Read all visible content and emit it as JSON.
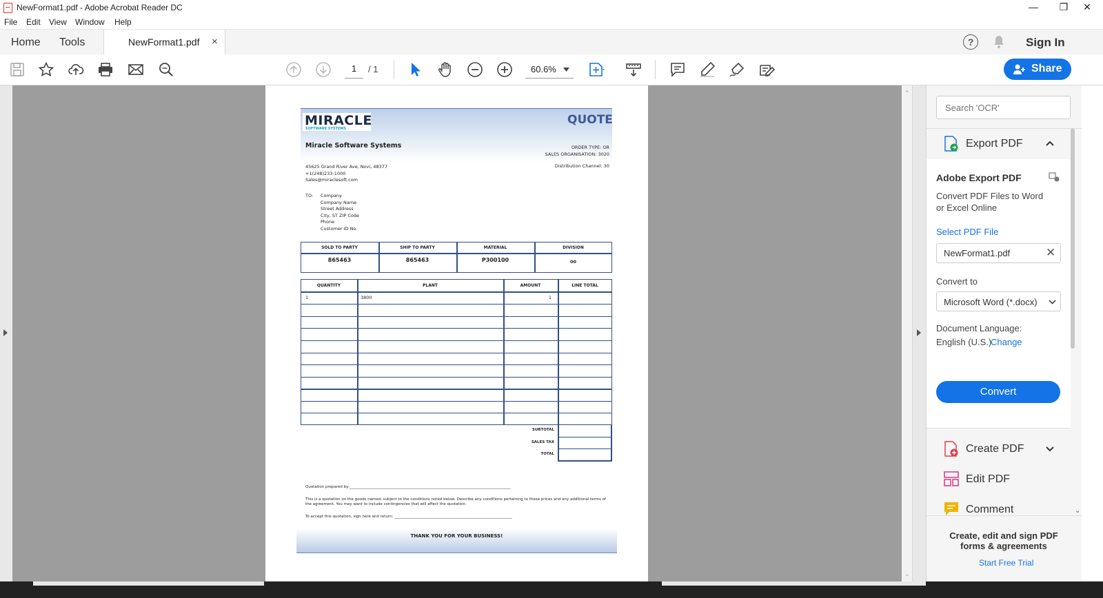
{
  "window": {
    "title": "NewFormat1.pdf - Adobe Acrobat Reader DC"
  },
  "menu": {
    "items": [
      "File",
      "Edit",
      "View",
      "Window",
      "Help"
    ]
  },
  "tabs": {
    "home": "Home",
    "tools": "Tools",
    "document": "NewFormat1.pdf",
    "close": "×"
  },
  "header_right": {
    "sign_in": "Sign In"
  },
  "toolbar": {
    "page_current": "1",
    "page_total": "/ 1",
    "zoom": "60.6%",
    "share_label": "Share"
  },
  "document": {
    "company_logo": "MIRACLE",
    "logo_subtitle": "SOFTWARE SYSTEMS",
    "heading": "QUOTE",
    "company_name": "Miracle Software Systems",
    "order_type": "ORDER TYPE: OR",
    "sales_org": "SALES ORGANISATION: 3020",
    "distribution_channel": "Distribution Channel: 30",
    "address": [
      "45625 Grand River Ave, Novi, 48377",
      "+1(248)233-1000",
      "Sales@miraclesoft.com"
    ],
    "to_label": "TO:",
    "to_lines": [
      "Company",
      "Company Name",
      "Street Address",
      "City, ST ZIP Code",
      "Phone",
      "Customer ID No."
    ],
    "party_headers": [
      "SOLD TO PARTY",
      "SHIP TO PARTY",
      "MATERIAL",
      "DIVISION"
    ],
    "party_values": [
      "865463",
      "865463",
      "P300100",
      "00"
    ],
    "item_headers": [
      "QUANTITY",
      "PLANT",
      "AMOUNT",
      "LINE TOTAL"
    ],
    "item_row": {
      "quantity": "1",
      "plant": "3800",
      "amount": "1",
      "line_total": ""
    },
    "totals": [
      "SUBTOTAL",
      "SALES TAX",
      "TOTAL"
    ],
    "prepared_by": "Quotation prepared by:_____________________________________________________________________________________",
    "terms": "This is a quotation on the goods named, subject to the conditions noted below: Describe any conditions pertaining to these prices and any additional terms of the agreement. You may want to include contingencies that will affect the quotation.",
    "accept": "To accept this quotation, sign here and return: ______________________________________________________________",
    "thanks": "THANK YOU FOR YOUR BUSINESS!"
  },
  "panel": {
    "search_placeholder": "Search 'OCR'",
    "export_title": "Export PDF",
    "adobe_export": "Adobe Export PDF",
    "export_desc": "Convert PDF Files to Word or Excel Online",
    "select_file": "Select PDF File",
    "file_name": "NewFormat1.pdf",
    "convert_to_label": "Convert to",
    "convert_to_value": "Microsoft Word (*.docx)",
    "doc_lang_label": "Document Language:",
    "doc_lang_value": "English (U.S.)",
    "change": "Change",
    "convert_button": "Convert",
    "tools": [
      "Create PDF",
      "Edit PDF",
      "Comment"
    ],
    "promo": "Create, edit and sign PDF forms & agreements",
    "trial": "Start Free Trial"
  },
  "colors": {
    "accent": "#1473e6",
    "table_border": "#2f4f8a",
    "canvas": "#9d9d9d",
    "create_pdf_icon": "#e0404b",
    "edit_pdf_icon": "#e0408a",
    "comment_icon": "#f0b400"
  }
}
